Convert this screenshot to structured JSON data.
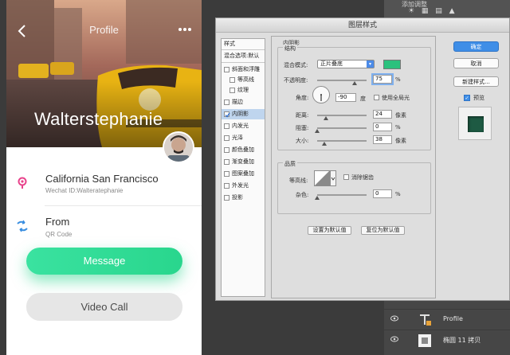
{
  "phone": {
    "title": "Profile",
    "name": "Walterstephanie",
    "location": "California San Francisco",
    "wechat": "Wechat ID:Walteratephanie",
    "from_label": "From",
    "from_sub": "QR Code",
    "message_btn": "Message",
    "video_btn": "Video Call",
    "icons": {
      "back": "back-icon",
      "more": "more-icon",
      "location": "location-icon",
      "from": "qr-code-icon"
    },
    "colors": {
      "accent": "#29d68d",
      "location_icon": "#e8428b",
      "from_icon": "#3a8ee0"
    }
  },
  "photoshop": {
    "top_panel_label": "添加调整",
    "adjust_icons": "☀ ▦ ▤ ▲",
    "layers": [
      {
        "name": "Profile",
        "type": "text"
      },
      {
        "name": "椭圆 11 拷贝",
        "type": "shape"
      }
    ]
  },
  "dialog": {
    "title": "图层样式",
    "styles": [
      {
        "label": "样式",
        "checkbox": false,
        "header": true
      },
      {
        "label": "混合选项:默认",
        "checkbox": false,
        "header": true
      },
      {
        "label": "斜面和浮雕",
        "checkbox": true,
        "checked": false
      },
      {
        "label": "等高线",
        "checkbox": true,
        "checked": false,
        "indent": true
      },
      {
        "label": "纹理",
        "checkbox": true,
        "checked": false,
        "indent": true
      },
      {
        "label": "描边",
        "checkbox": true,
        "checked": false
      },
      {
        "label": "内阴影",
        "checkbox": true,
        "checked": true,
        "selected": true
      },
      {
        "label": "内发光",
        "checkbox": true,
        "checked": false
      },
      {
        "label": "光泽",
        "checkbox": true,
        "checked": false
      },
      {
        "label": "颜色叠加",
        "checkbox": true,
        "checked": false
      },
      {
        "label": "渐变叠加",
        "checkbox": true,
        "checked": false
      },
      {
        "label": "图案叠加",
        "checkbox": true,
        "checked": false
      },
      {
        "label": "外发光",
        "checkbox": true,
        "checked": false
      },
      {
        "label": "投影",
        "checkbox": true,
        "checked": false
      }
    ],
    "inner_shadow": {
      "section_title": "内阴影",
      "structure_title": "结构",
      "blend_mode_label": "混合模式:",
      "blend_mode_value": "正片叠底",
      "shadow_color": "#2bc17d",
      "opacity_label": "不透明度:",
      "opacity_value": "75",
      "opacity_unit": "%",
      "opacity_pct": 75,
      "angle_label": "角度:",
      "angle_value": "-90",
      "angle_unit": "度",
      "global_light_label": "使用全局光",
      "distance_label": "距离:",
      "distance_value": "24",
      "distance_unit": "像素",
      "distance_pct": 17,
      "choke_label": "阻塞:",
      "choke_value": "0",
      "choke_unit": "%",
      "choke_pct": 0,
      "size_label": "大小:",
      "size_value": "38",
      "size_unit": "像素",
      "size_pct": 15,
      "quality_title": "品质",
      "contour_label": "等高线:",
      "antialias_label": "消除锯齿",
      "noise_label": "杂色:",
      "noise_value": "0",
      "noise_unit": "%",
      "noise_pct": 0,
      "set_default": "设置为默认值",
      "reset_default": "复位为默认值"
    },
    "buttons": {
      "ok": "确定",
      "cancel": "取消",
      "new_style": "新建样式...",
      "preview": "预览"
    },
    "preview_color": "#1e5a43"
  }
}
